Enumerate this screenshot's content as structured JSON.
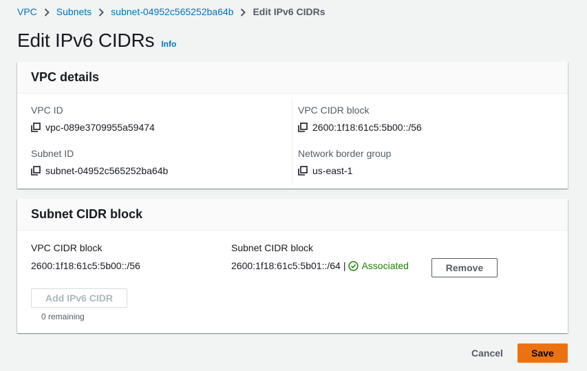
{
  "breadcrumb": {
    "items": [
      "VPC",
      "Subnets",
      "subnet-04952c565252ba64b"
    ],
    "current": "Edit IPv6 CIDRs"
  },
  "page": {
    "title": "Edit IPv6 CIDRs",
    "info_label": "Info"
  },
  "vpc_details": {
    "title": "VPC details",
    "vpc_id_label": "VPC ID",
    "vpc_id_value": "vpc-089e3709955a59474",
    "subnet_id_label": "Subnet ID",
    "subnet_id_value": "subnet-04952c565252ba64b",
    "vpc_cidr_label": "VPC CIDR block",
    "vpc_cidr_value": "2600:1f18:61c5:5b00::/56",
    "border_group_label": "Network border group",
    "border_group_value": "us-east-1"
  },
  "subnet_cidr": {
    "title": "Subnet CIDR block",
    "vpc_cidr_label": "VPC CIDR block",
    "vpc_cidr_value": "2600:1f18:61c5:5b00::/56",
    "subnet_cidr_label": "Subnet CIDR block",
    "subnet_cidr_value": "2600:1f18:61c5:5b01::/64",
    "separator": "|",
    "status": "Associated",
    "remove_label": "Remove",
    "add_label": "Add IPv6 CIDR",
    "remaining": "0 remaining"
  },
  "footer": {
    "cancel_label": "Cancel",
    "save_label": "Save"
  },
  "colors": {
    "link": "#0073bb",
    "primary": "#ec7211",
    "success": "#1d8102"
  },
  "icons": {
    "copy": "copy-icon",
    "status": "check-circle-icon",
    "separator": "chevron-right-icon"
  }
}
